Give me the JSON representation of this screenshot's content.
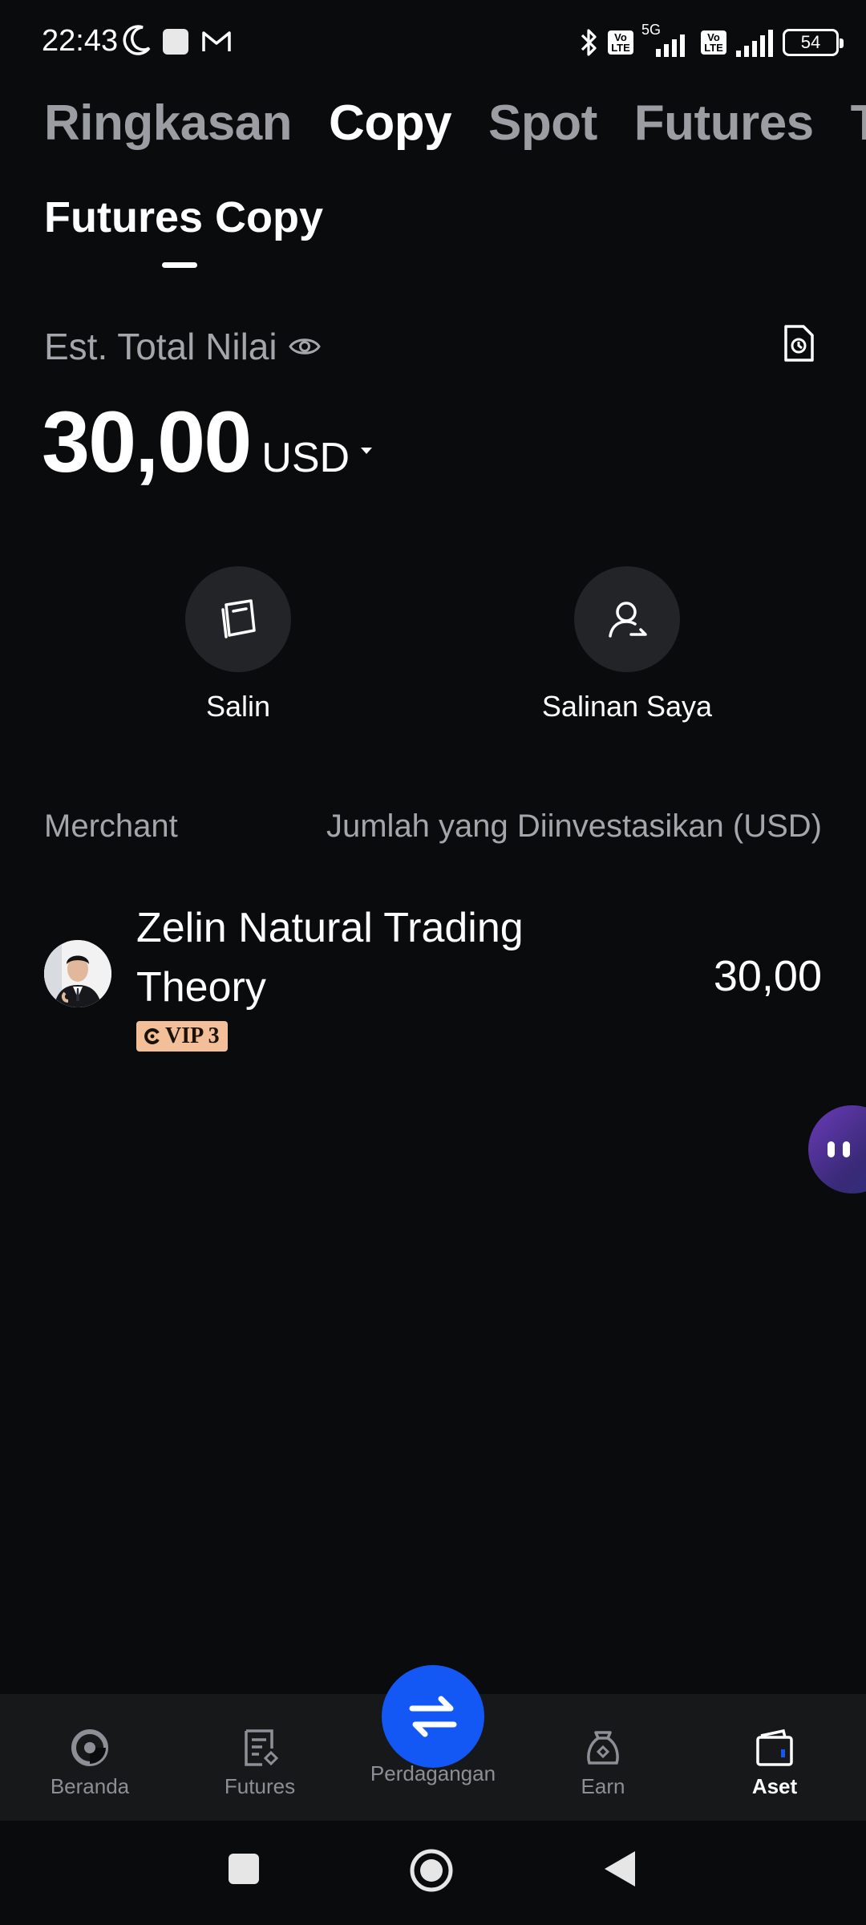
{
  "status_bar": {
    "time": "22:43",
    "network": "5G",
    "volte_1": "Vo LTE",
    "volte_2": "Vo LTE",
    "battery": "54"
  },
  "top_tabs": [
    {
      "label": "Ringkasan",
      "active": false
    },
    {
      "label": "Copy",
      "active": true
    },
    {
      "label": "Spot",
      "active": false
    },
    {
      "label": "Futures",
      "active": false
    },
    {
      "label": "Tr",
      "active": false
    }
  ],
  "sub_tab": {
    "label": "Futures Copy"
  },
  "balance": {
    "label": "Est. Total Nilai",
    "amount": "30,00",
    "currency": "USD"
  },
  "actions": [
    {
      "label": "Salin",
      "icon": "copy-card-icon"
    },
    {
      "label": "Salinan Saya",
      "icon": "user-copy-icon"
    }
  ],
  "list": {
    "header_left": "Merchant",
    "header_right": "Jumlah yang Diinvestasikan (USD)",
    "rows": [
      {
        "name": "Zelin Natural Trading Theory",
        "badge": "VIP 3",
        "amount": "30,00"
      }
    ]
  },
  "bottom_nav": [
    {
      "label": "Beranda",
      "icon": "home-icon",
      "active": false
    },
    {
      "label": "Futures",
      "icon": "futures-icon",
      "active": false
    },
    {
      "label": "Perdagangan",
      "icon": "trade-swap-icon",
      "active": false
    },
    {
      "label": "Earn",
      "icon": "earn-icon",
      "active": false
    },
    {
      "label": "Aset",
      "icon": "wallet-icon",
      "active": true
    }
  ],
  "colors": {
    "background": "#0a0b0c",
    "accent": "#1357f5",
    "muted_text": "#a3a7ab",
    "vip_badge": "#f3bf98",
    "nav_bg": "#17181a"
  }
}
